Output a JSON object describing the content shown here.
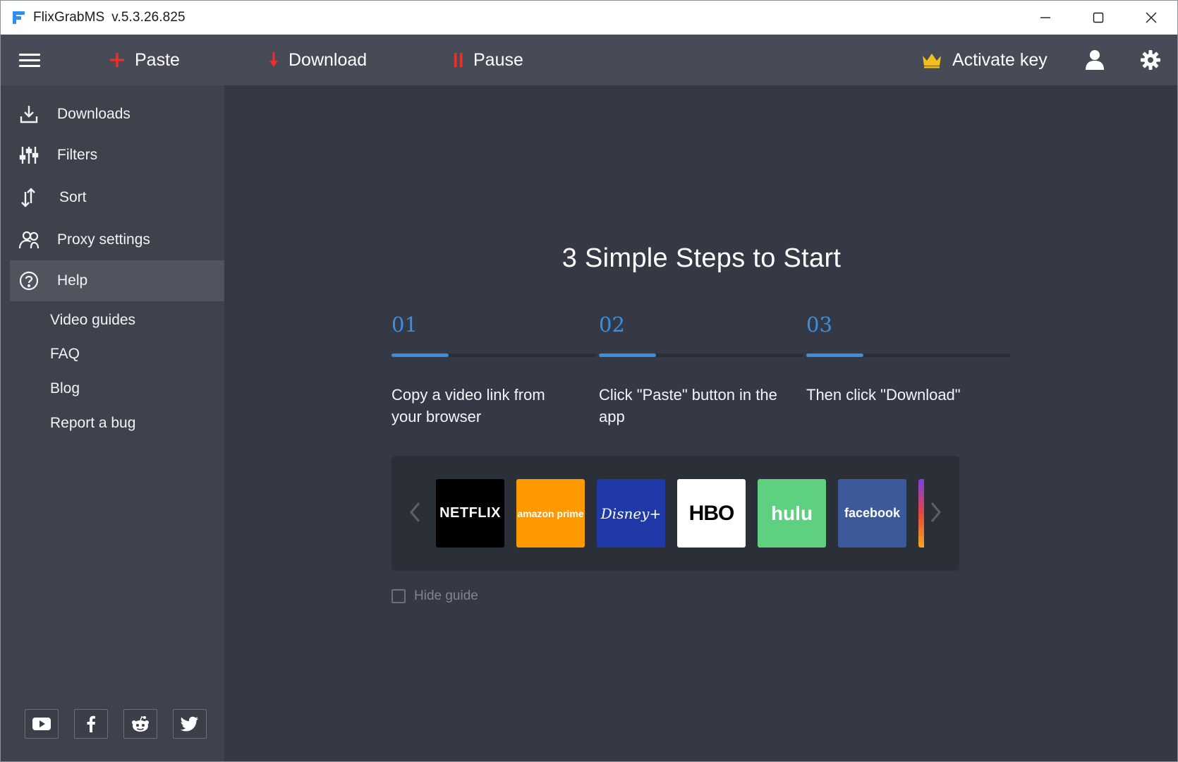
{
  "window": {
    "app_name": "FlixGrabMS",
    "version": "v.5.3.26.825",
    "accent_color": "#3a8fe0"
  },
  "toolbar": {
    "menu_icon": "hamburger-icon",
    "paste_label": "Paste",
    "download_label": "Download",
    "pause_label": "Pause",
    "activate_label": "Activate key"
  },
  "sidebar": {
    "items": [
      {
        "label": "Downloads",
        "icon": "download-icon"
      },
      {
        "label": "Filters",
        "icon": "sliders-icon"
      },
      {
        "label": "Sort",
        "icon": "sort-icon"
      },
      {
        "label": "Proxy settings",
        "icon": "proxy-icon"
      },
      {
        "label": "Help",
        "icon": "help-icon",
        "active": true
      }
    ],
    "help_subitems": [
      "Video guides",
      "FAQ",
      "Blog",
      "Report a bug"
    ],
    "social": [
      "youtube-icon",
      "facebook-icon",
      "reddit-icon",
      "twitter-icon"
    ]
  },
  "guide": {
    "title": "3 Simple Steps to Start",
    "steps": [
      {
        "number": "01",
        "text": "Copy a video link from your browser",
        "progress": 0.28
      },
      {
        "number": "02",
        "text": "Click \"Paste\" button in the app",
        "progress": 0.28
      },
      {
        "number": "03",
        "text": "Then click \"Download\"",
        "progress": 0.28
      }
    ],
    "services": [
      {
        "name": "NETFLIX",
        "bg": "#000000",
        "fg": "#ffffff"
      },
      {
        "name": "amazon prime",
        "bg": "#ff9900",
        "fg": "#ffffff"
      },
      {
        "name": "Disney+",
        "bg": "#1f3aa8",
        "fg": "#ffffff"
      },
      {
        "name": "HBO",
        "bg": "#ffffff",
        "fg": "#000000"
      },
      {
        "name": "hulu",
        "bg": "#5fcf80",
        "fg": "#ffffff"
      },
      {
        "name": "facebook",
        "bg": "#3c5a99",
        "fg": "#ffffff"
      }
    ],
    "hide_guide_label": "Hide guide",
    "hide_guide_checked": false
  }
}
